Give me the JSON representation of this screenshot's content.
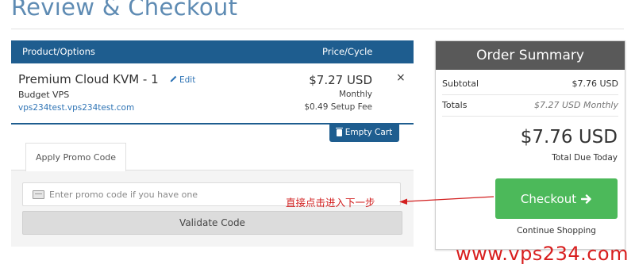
{
  "page": {
    "title": "Review & Checkout"
  },
  "cart": {
    "headers": {
      "product": "Product/Options",
      "price": "Price/Cycle"
    },
    "item": {
      "name": "Premium Cloud KVM - 1",
      "edit_label": "Edit",
      "group": "Budget VPS",
      "domain": "vps234test.vps234test.com",
      "price": "$7.27 USD",
      "cycle": "Monthly",
      "setup_fee": "$0.49 Setup Fee",
      "remove_symbol": "×"
    },
    "empty_cart_label": "Empty Cart"
  },
  "promo": {
    "tab_label": "Apply Promo Code",
    "placeholder": "Enter promo code if you have one",
    "validate_label": "Validate Code"
  },
  "summary": {
    "title": "Order Summary",
    "subtotal_label": "Subtotal",
    "subtotal_value": "$7.76 USD",
    "totals_label": "Totals",
    "totals_value": "$7.27 USD Monthly",
    "total_due_amount": "$7.76 USD",
    "total_due_label": "Total Due Today",
    "checkout_label": "Checkout",
    "checkout_icon": "arrow-right-icon",
    "continue_label": "Continue Shopping"
  },
  "annotation": {
    "text": "直接点击进入下一步"
  },
  "watermark": {
    "text": "www.vps234.com"
  },
  "colors": {
    "header_blue": "#1e5d8f",
    "title_blue": "#5e8bb3",
    "link_blue": "#2f74b5",
    "checkout_green": "#4cb95a",
    "summary_header": "#595959",
    "annotation_red": "#d21f1f"
  }
}
